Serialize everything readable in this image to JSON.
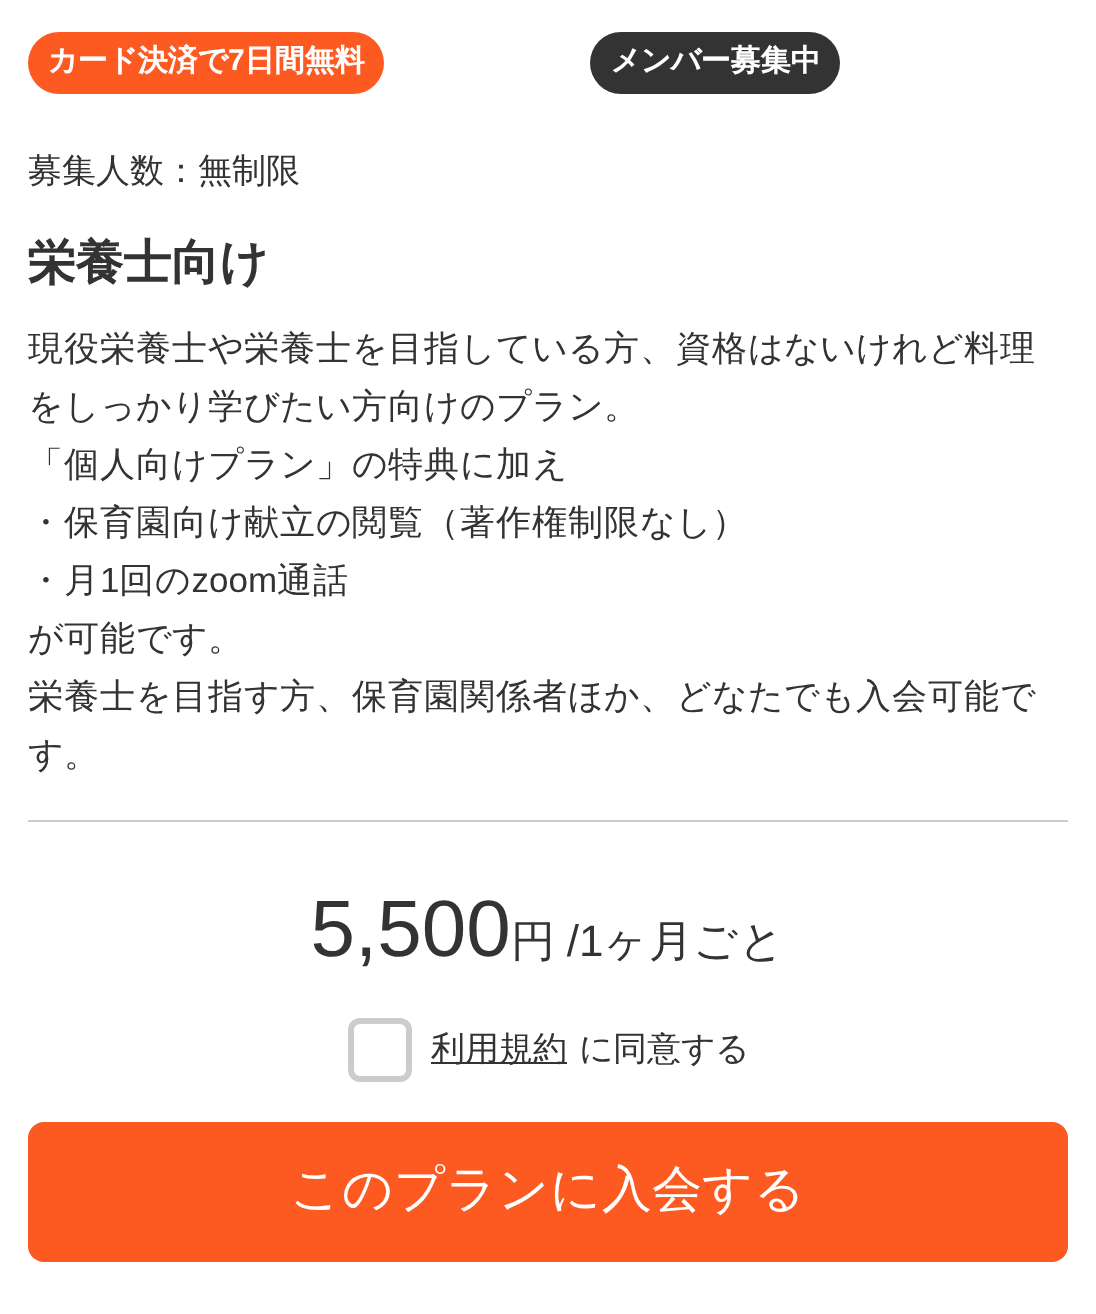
{
  "badges": [
    {
      "label": "カード決済で7日間無料",
      "color": "#fc5a21"
    },
    {
      "label": "メンバー募集中",
      "color": "#333333"
    }
  ],
  "capacity": "募集人数：無制限",
  "plan": {
    "title": "栄養士向け",
    "description": [
      "現役栄養士や栄養士を目指している方、資格はないけれど料理をしっかり学びたい方向けのプラン。",
      "「個人向けプラン」の特典に加え",
      "・保育園向け献立の閲覧（著作権制限なし）",
      "・月1回のzoom通話",
      "が可能です。",
      "栄養士を目指す方、保育園関係者ほか、どなたでも入会可能です。"
    ]
  },
  "price": {
    "amount": "5,500",
    "unit": "円",
    "period": "/1ヶ月ごと"
  },
  "agreement": {
    "checked": false,
    "link": "利用規約",
    "text": "に同意する"
  },
  "join_button": "このプランに入会する"
}
